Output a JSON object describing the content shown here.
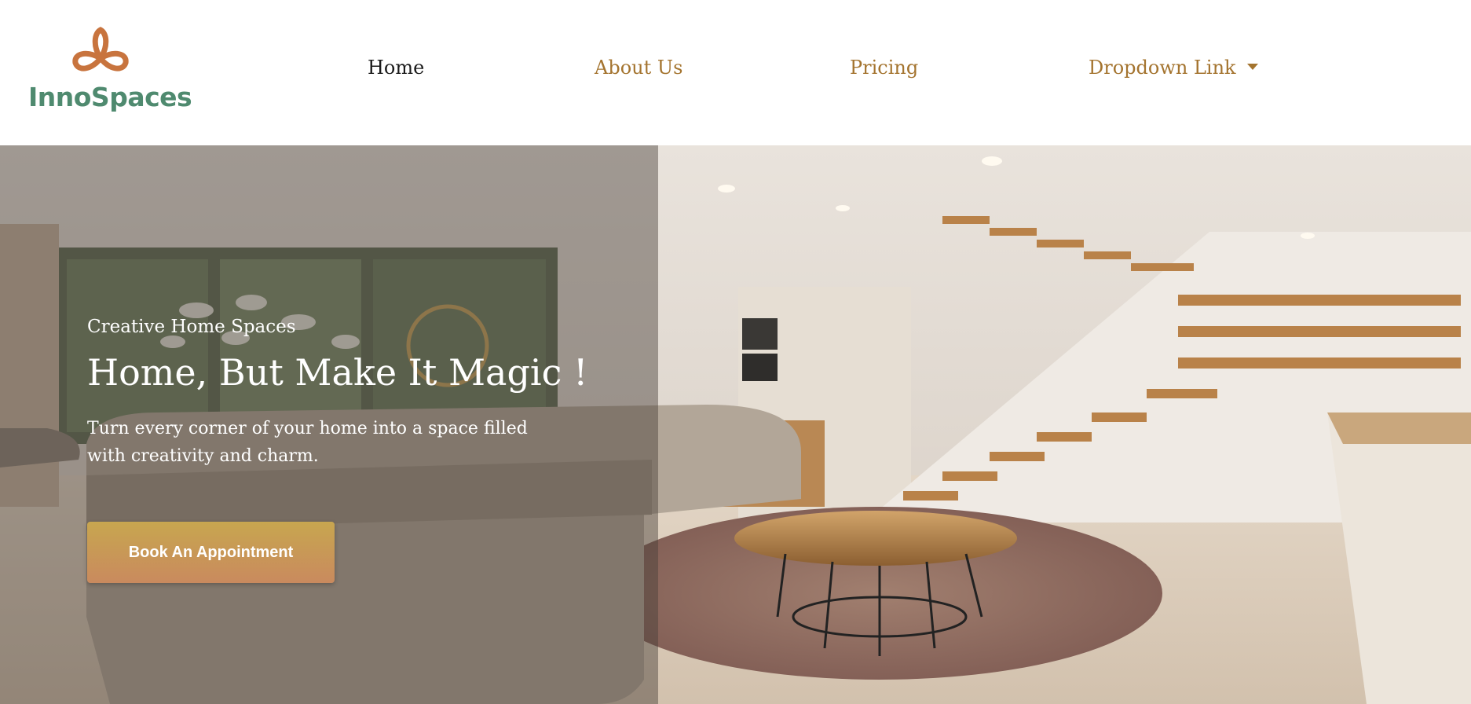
{
  "brand": {
    "name": "InnoSpaces",
    "logo_icon": "flower-icon",
    "accent_color": "#c8743e",
    "text_color": "#4f8a6f"
  },
  "nav": {
    "items": [
      {
        "label": "Home",
        "active": true
      },
      {
        "label": "About Us"
      },
      {
        "label": "Pricing"
      },
      {
        "label": "Dropdown Link",
        "icon": "caret-down-icon"
      }
    ],
    "link_color": "#a4742f",
    "active_color": "#1a1a1a"
  },
  "hero": {
    "eyebrow": "Creative Home Spaces",
    "headline": "Home, But Make It Magic !",
    "subtext": "Turn every corner of your home into a space filled with creativity and charm.",
    "cta_label": "Book An Appointment"
  }
}
